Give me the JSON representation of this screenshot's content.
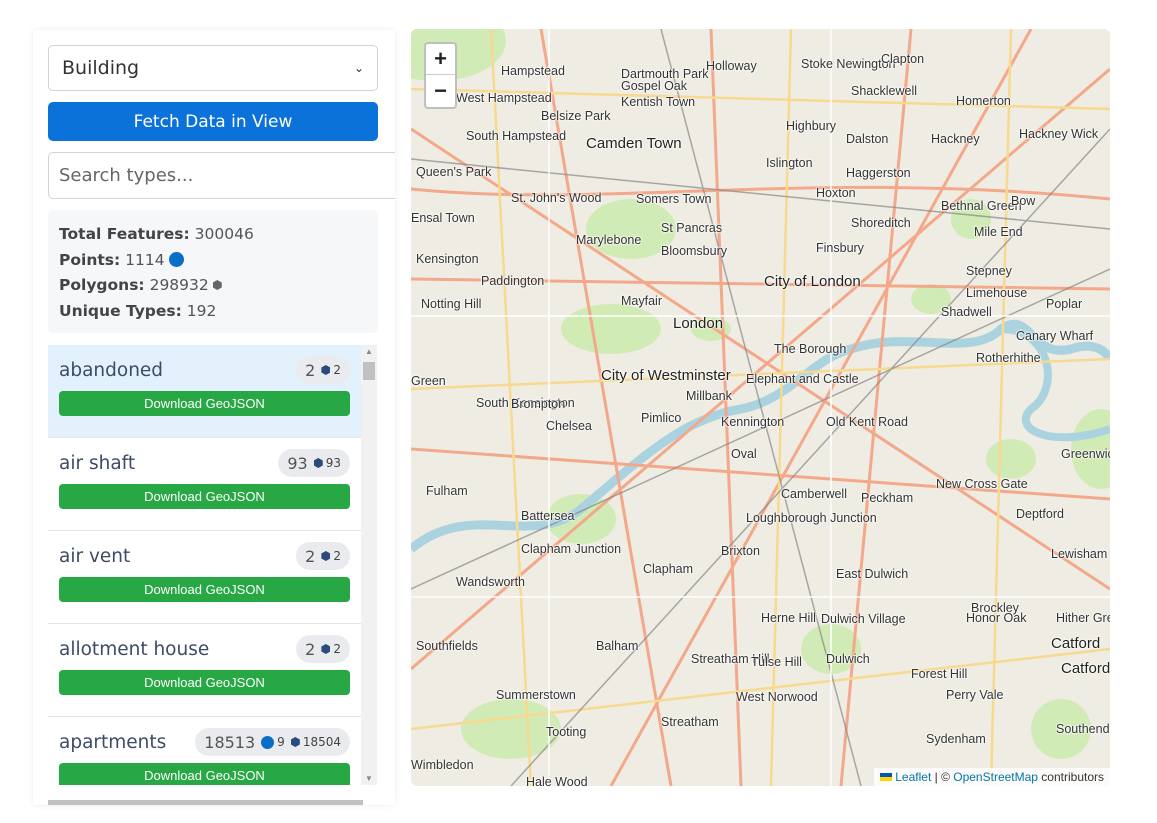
{
  "sidebar": {
    "select_value": "Building",
    "fetch_label": "Fetch Data in View",
    "search_placeholder": "Search types...",
    "stats": {
      "total_label": "Total Features:",
      "total": "300046",
      "points_label": "Points:",
      "points": "1114",
      "polygons_label": "Polygons:",
      "polygons": "298932",
      "unique_label": "Unique Types:",
      "unique": "192"
    },
    "download_label": "Download GeoJSON",
    "items": [
      {
        "name": "abandoned",
        "total": "2",
        "points": null,
        "polygons": "2"
      },
      {
        "name": "air shaft",
        "total": "93",
        "points": null,
        "polygons": "93"
      },
      {
        "name": "air vent",
        "total": "2",
        "points": null,
        "polygons": "2"
      },
      {
        "name": "allotment house",
        "total": "2",
        "points": null,
        "polygons": "2"
      },
      {
        "name": "apartments",
        "total": "18513",
        "points": "9",
        "polygons": "18504"
      }
    ]
  },
  "map": {
    "zoom_in": "+",
    "zoom_out": "−",
    "attribution": {
      "leaflet": "Leaflet",
      "sep": " | © ",
      "osm": "OpenStreetMap",
      "rest": " contributors"
    },
    "labels": [
      "Hampstead",
      "Dartmouth Park",
      "Holloway",
      "Stoke Newington",
      "Clapton",
      "Gospel Oak",
      "Shacklewell",
      "West Hampstead",
      "Kentish Town",
      "Homerton",
      "Belsize Park",
      "Highbury",
      "South Hampstead",
      "Camden Town",
      "Dalston",
      "Hackney",
      "Hackney Wick",
      "Queen's Park",
      "Islington",
      "Haggerston",
      "St. John's Wood",
      "Somers Town",
      "Hoxton",
      "Bethnal Green",
      "Bow",
      "Ensal Town",
      "Marylebone",
      "St Pancras",
      "Shoreditch",
      "Mile End",
      "Kensington",
      "Bloomsbury",
      "Finsbury",
      "Stepney",
      "Paddington",
      "City of London",
      "Limehouse",
      "Poplar",
      "Notting Hill",
      "Mayfair",
      "Shadwell",
      "London",
      "Canary Wharf",
      "The Borough",
      "Rotherhithe",
      "City of Westminster",
      "South Kensington",
      "Elephant and Castle",
      "Green",
      "Brompton",
      "Millbank",
      "Pimlico",
      "Chelsea",
      "Kennington",
      "Old Kent Road",
      "Fulham",
      "Oval",
      "Greenwich",
      "Battersea",
      "Camberwell",
      "Peckham",
      "New Cross Gate",
      "Deptford",
      "Loughborough Junction",
      "Clapham Junction",
      "Clapham",
      "Brixton",
      "Lewisham",
      "Wandsworth",
      "East Dulwich",
      "Brockley",
      "Herne Hill",
      "Dulwich Village",
      "Honor Oak",
      "Hither Green",
      "Southfields",
      "Balham",
      "Streatham Hill",
      "Tulse Hill",
      "Dulwich",
      "Catford",
      "Forest Hill",
      "Catford",
      "West Norwood",
      "Perry Vale",
      "Summerstown",
      "Streatham",
      "Tooting",
      "Sydenham",
      "Southend",
      "Wimbledon",
      "Hale Wood"
    ]
  },
  "colors": {
    "accent": "#0b72d9",
    "download": "#28a745",
    "point": "#0a6ec6",
    "polygon": "#2c4a7c"
  }
}
